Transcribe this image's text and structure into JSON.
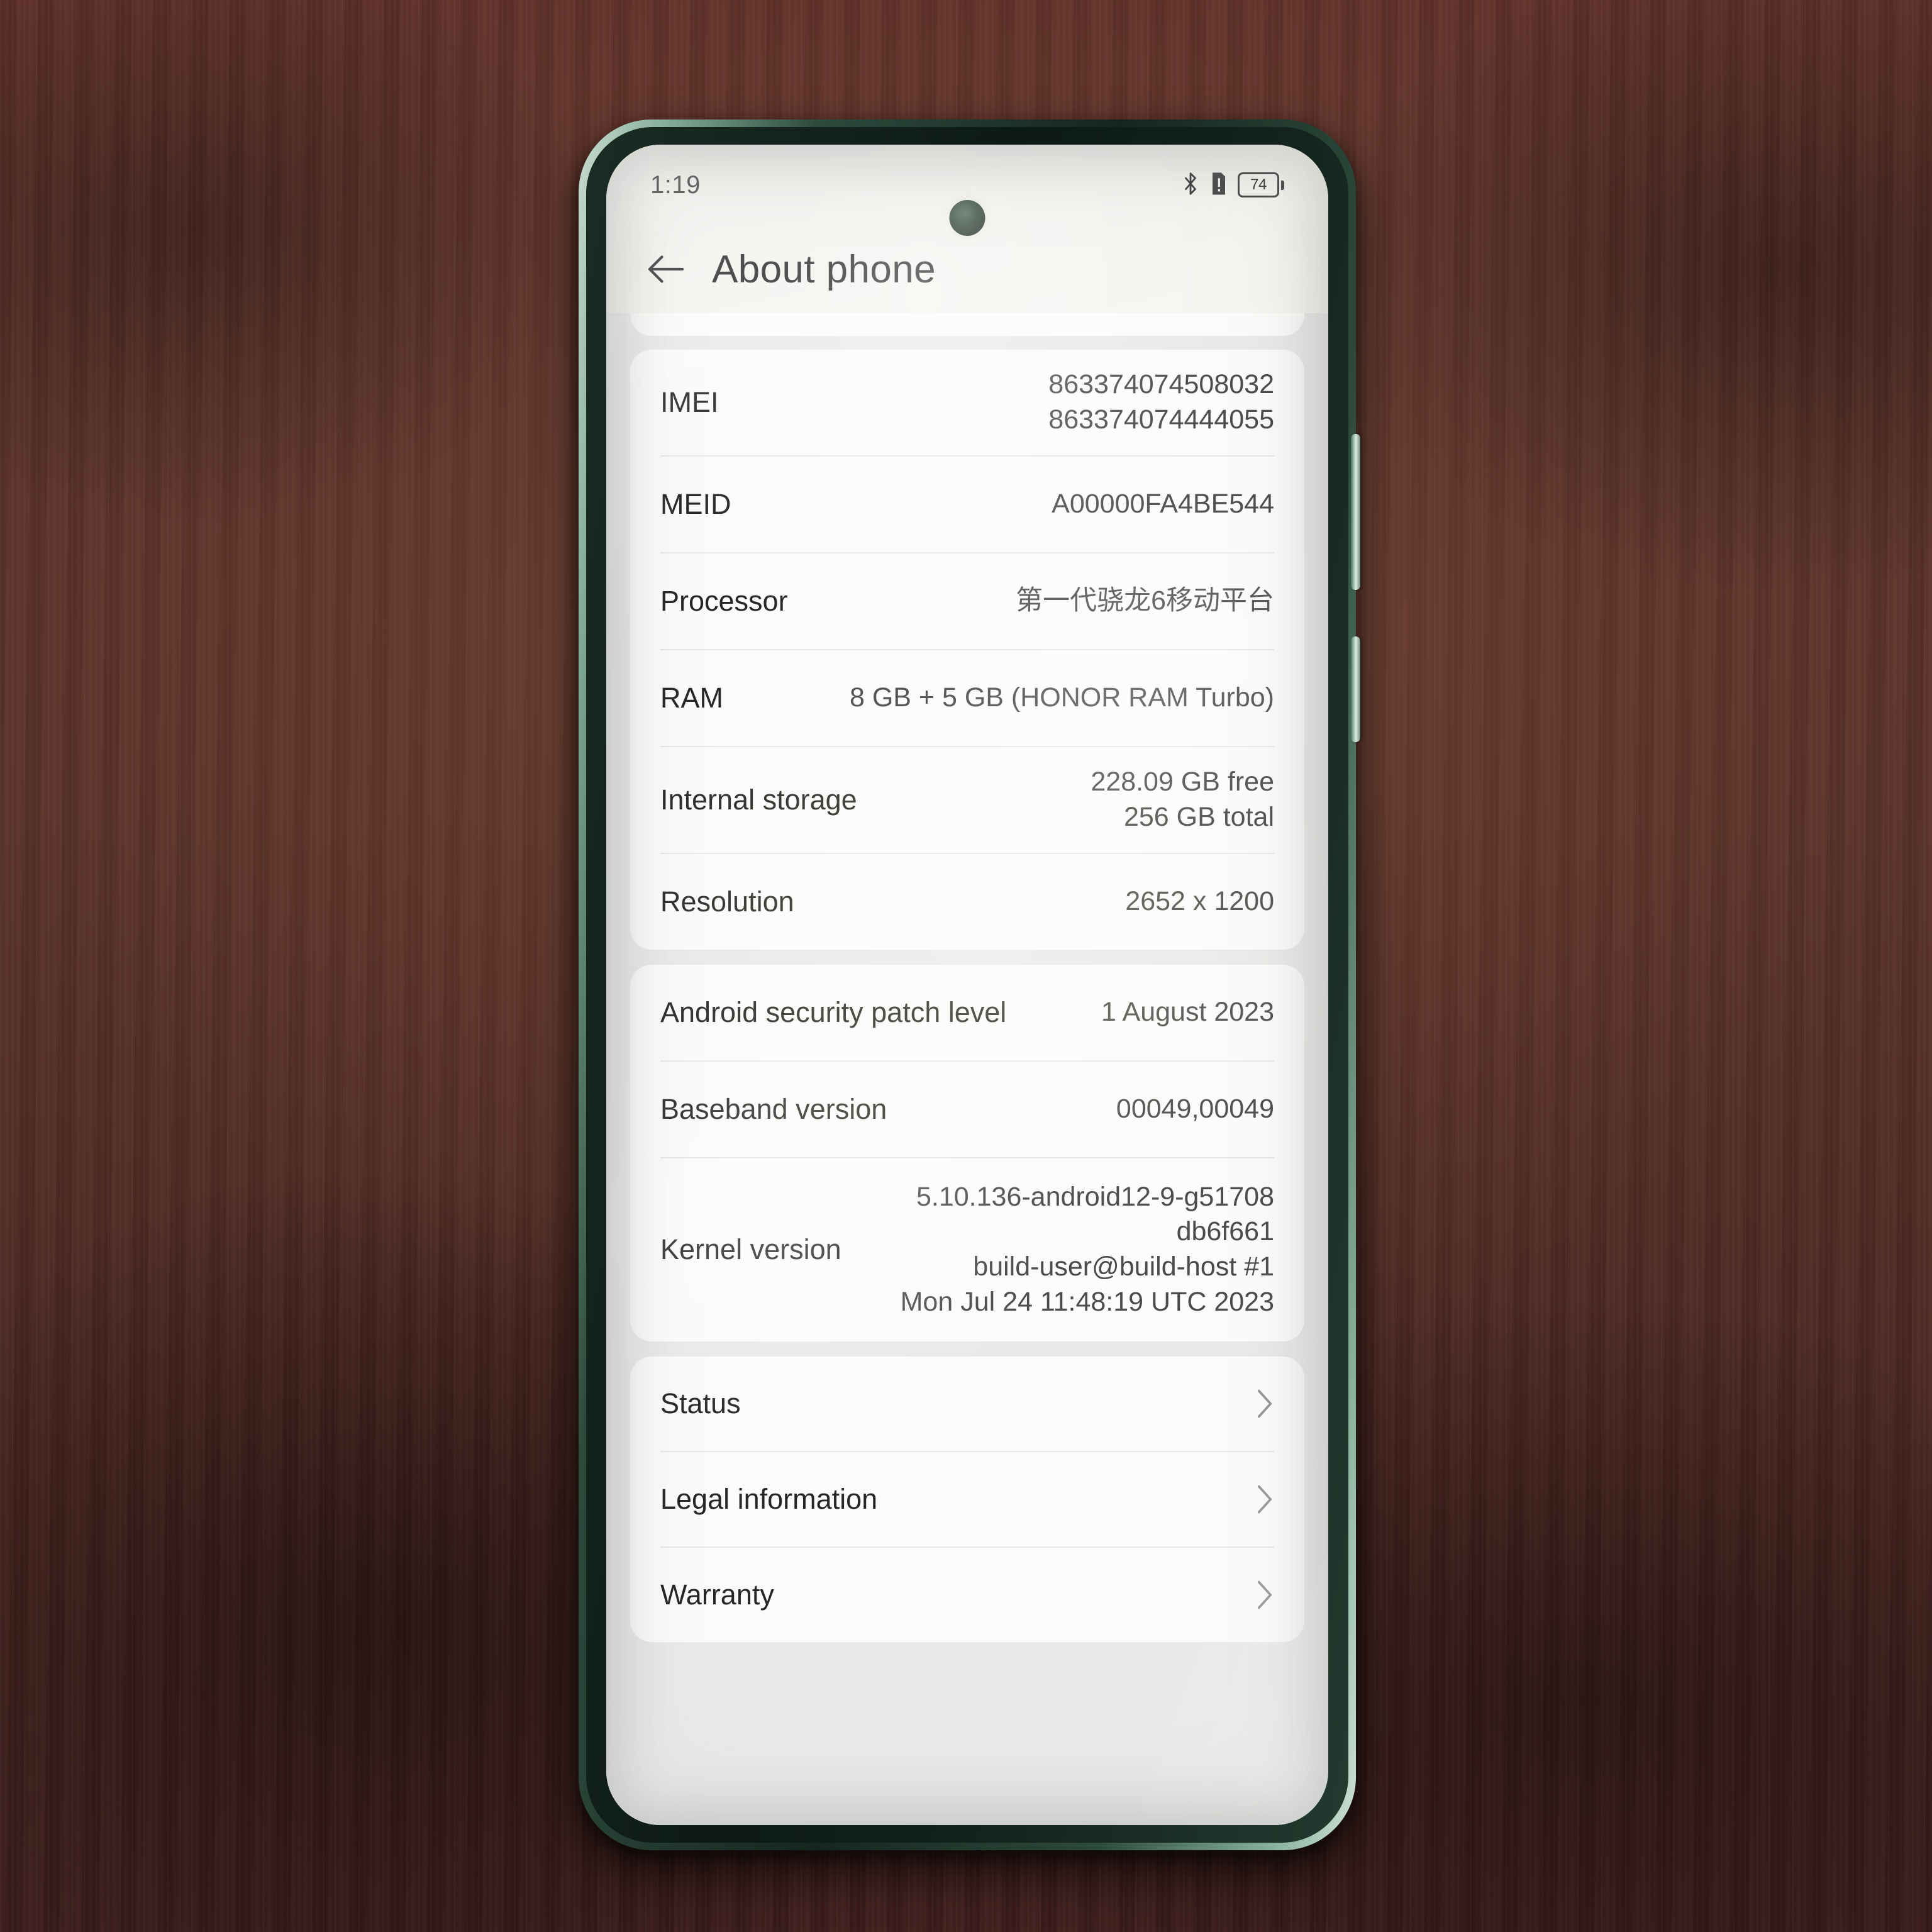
{
  "status_bar": {
    "time": "1:19",
    "icons": [
      {
        "name": "bluetooth-icon",
        "label": "Bluetooth"
      },
      {
        "name": "sim-alert-icon",
        "label": "No SIM"
      },
      {
        "name": "battery-icon",
        "label": "74"
      }
    ],
    "battery_level": "74"
  },
  "header": {
    "back_label": "Back",
    "title": "About phone"
  },
  "sections": [
    {
      "name": "device-info-card",
      "rows": [
        {
          "label": "IMEI",
          "lines": [
            "863374074508032",
            "863374074444055"
          ]
        },
        {
          "label": "MEID",
          "lines": [
            "A00000FA4BE544"
          ]
        },
        {
          "label": "Processor",
          "lines": [
            "第一代骁龙6移动平台"
          ]
        },
        {
          "label": "RAM",
          "lines": [
            "8 GB + 5 GB (HONOR RAM Turbo)"
          ]
        },
        {
          "label": "Internal storage",
          "lines": [
            "228.09  GB free",
            "256  GB total"
          ]
        },
        {
          "label": "Resolution",
          "lines": [
            "2652 x 1200"
          ]
        }
      ]
    },
    {
      "name": "software-info-card",
      "rows": [
        {
          "label": "Android security patch level",
          "lines": [
            "1 August 2023"
          ]
        },
        {
          "label": "Baseband version",
          "lines": [
            "00049,00049"
          ]
        },
        {
          "label": "Kernel version",
          "lines": [
            "5.10.136-android12-9-g51708",
            "db6f661",
            "build-user@build-host #1",
            "Mon Jul 24 11:48:19 UTC 2023"
          ]
        }
      ]
    }
  ],
  "nav_card": {
    "name": "links-card",
    "items": [
      {
        "label": "Status",
        "icon": "chevron-right-icon"
      },
      {
        "label": "Legal information",
        "icon": "chevron-right-icon"
      },
      {
        "label": "Warranty",
        "icon": "chevron-right-icon"
      }
    ]
  },
  "hardware": {
    "volume_button": "Volume rocker",
    "power_button": "Power button"
  },
  "colors": {
    "frame": "#2d4a3d",
    "screen_bg": "#e9eae8",
    "card_bg": "#fbfbf9",
    "text_primary": "#262626",
    "text_secondary": "#4b4b4b",
    "desk": "#5a3228"
  }
}
